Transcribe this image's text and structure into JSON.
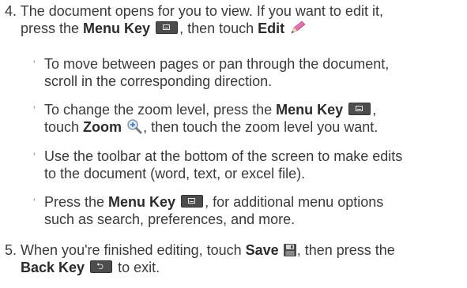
{
  "step4": {
    "number": "4.",
    "text_a": "The document opens for you to view. If you want to edit it,",
    "text_b1": "press the ",
    "menu_key": "Menu Key",
    "text_b2": ", then touch ",
    "edit": "Edit"
  },
  "bullets": [
    {
      "line1": "To move between pages or pan through the document,",
      "line2": "scroll in the corresponding direction."
    },
    {
      "line1a": "To change the zoom level, press the ",
      "menu_key": "Menu Key",
      "line1b": ",",
      "line2a": "touch ",
      "zoom": "Zoom",
      "line2b": ", then touch the zoom level you want."
    },
    {
      "line1": "Use the toolbar at the bottom of the screen to make edits",
      "line2": "to the document (word, text, or excel file)."
    },
    {
      "line1a": "Press the ",
      "menu_key": "Menu Key",
      "line1b": ", for additional menu options",
      "line2": "such as search, preferences, and more."
    }
  ],
  "step5": {
    "number": "5.",
    "text_a1": "When you're finished editing, touch ",
    "save": "Save",
    "text_a2": ", then press the",
    "back_key": "Back Key",
    "text_b2": " to exit."
  },
  "icons": {
    "menu_key": "menu-key-icon",
    "edit": "pencil-icon",
    "zoom": "magnifier-zoom-icon",
    "save": "floppy-disk-icon",
    "back_key": "back-arrow-key-icon"
  }
}
